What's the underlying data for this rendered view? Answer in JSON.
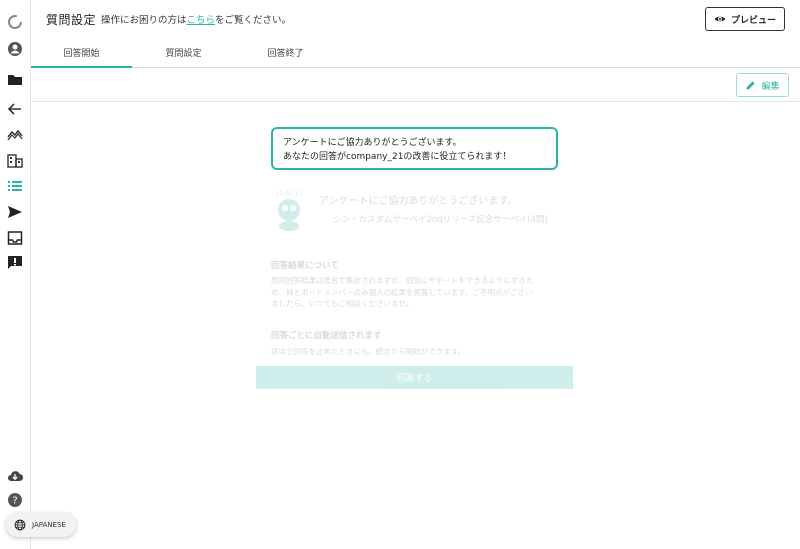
{
  "header": {
    "title": "質問設定",
    "help_prefix": "操作にお困りの方は",
    "help_link": "こちら",
    "help_suffix": "をご覧ください。",
    "preview_label": "プレビュー"
  },
  "tabs": [
    {
      "label": "回答開始",
      "active": true
    },
    {
      "label": "質問設定",
      "active": false
    },
    {
      "label": "回答終了",
      "active": false
    }
  ],
  "toolbar": {
    "edit_label": "編集"
  },
  "callout": {
    "line1": "アンケートにご協力ありがとうございます。",
    "line2": "あなたの回答がcompany_21の改善に役立てられます！"
  },
  "preview_content": {
    "heading": "アンケートにご協力ありがとうございます。",
    "survey_name": "シン・カスタムサーベイ2ndリリース記念サーベイ(4問)",
    "results_title": "回答結果について",
    "results_body_1": "原則回答結果は匿名で集計されますが、個別にサポートをできるようにするた",
    "results_body_2": "め、林とボードメンバーのみ個人の結果を閲覧しています。ご不明点がござい",
    "results_body_3": "ましたら、いつでもご相談くださいませ。",
    "autosave_title": "回答ごとに自動送信されます",
    "autosave_body": "途中で回答を止めたときにも、続きから開始ができます。",
    "answer_button": "回答する"
  },
  "language": {
    "label": "JAPANESE"
  },
  "colors": {
    "accent": "#2bb5a8"
  },
  "sidebar_icons": [
    "logo-icon",
    "user-icon",
    "folder-icon",
    "back-arrow-icon",
    "trend-icon",
    "building-icon",
    "list-icon",
    "send-icon",
    "inbox-icon",
    "feedback-icon",
    "cloud-download-icon",
    "help-icon"
  ]
}
